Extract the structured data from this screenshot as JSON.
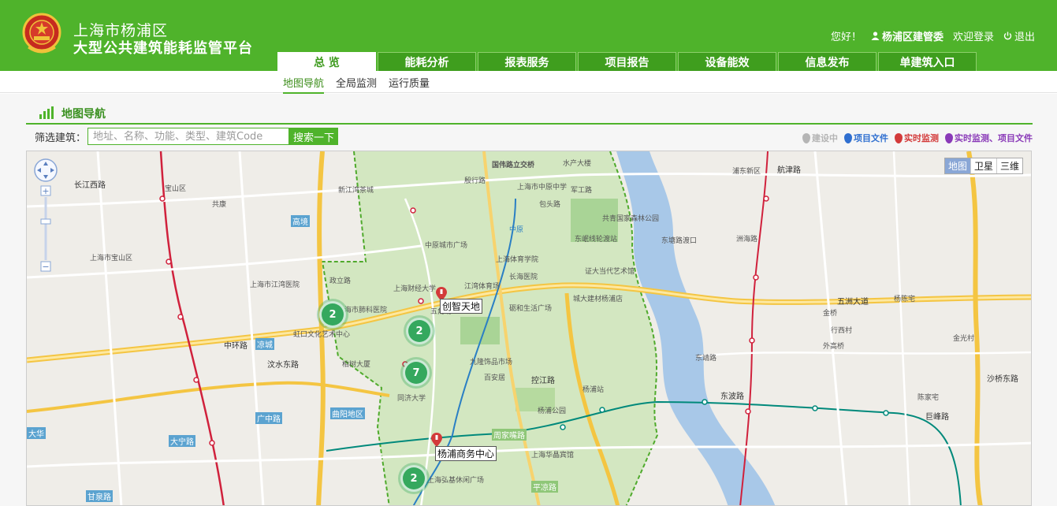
{
  "header": {
    "brand_line1": "上海市杨浦区",
    "brand_line2": "大型公共建筑能耗监管平台",
    "greeting": "您好！",
    "user": "杨浦区建管委",
    "welcome": "欢迎登录",
    "logout": "退出"
  },
  "nav": {
    "tabs": [
      {
        "label": "总  览",
        "active": true
      },
      {
        "label": "能耗分析"
      },
      {
        "label": "报表服务"
      },
      {
        "label": "项目报告"
      },
      {
        "label": "设备能效"
      },
      {
        "label": "信息发布"
      },
      {
        "label": "单建筑入口"
      }
    ]
  },
  "subnav": {
    "items": [
      {
        "label": "地图导航",
        "active": true
      },
      {
        "label": "全局监测"
      },
      {
        "label": "运行质量"
      }
    ]
  },
  "section": {
    "title": "地图导航"
  },
  "filter": {
    "label": "筛选建筑：",
    "placeholder": "地址、名称、功能、类型、建筑Code",
    "button": "搜索一下"
  },
  "legend": [
    {
      "label": "建设中",
      "color": "#b5b5b5"
    },
    {
      "label": "项目文件",
      "color": "#2f6fd0"
    },
    {
      "label": "实时监测",
      "color": "#d33a3a"
    },
    {
      "label": "实时监测、项目文件",
      "color": "#8a3ab8"
    }
  ],
  "map": {
    "types": [
      "地图",
      "卫星",
      "三维"
    ],
    "clusters": [
      "2",
      "2",
      "7",
      "2"
    ],
    "poi_labels": [
      "创智天地",
      "杨浦商务中心"
    ],
    "places": [
      "国伟路立交桥",
      "殷行路",
      "水产大楼",
      "新江湾茶城",
      "上海市中原中学",
      "军工路",
      "中原",
      "包头路",
      "中原城市广场",
      "上海体育学院",
      "长海医院",
      "共青国家森林公园",
      "东岷线轮渡站",
      "东塘路渡口",
      "政立路",
      "上海财经大学",
      "江湾体育场",
      "证大当代艺术馆",
      "城大建材杨浦店",
      "上海市肺科医院",
      "五角场",
      "砺和生活广场",
      "上海市江湾医院",
      "虹口文化艺术中心",
      "柏树大厦",
      "九隆饰品市场",
      "百安居",
      "同济大学",
      "杨浦站",
      "杨浦公园",
      "控江路",
      "周家嘴路",
      "上海华晶宾馆",
      "平凉路",
      "上海弘基休闲广场",
      "曲阳地区",
      "凉城",
      "广中路",
      "汶水东路",
      "中环路",
      "五洲大道",
      "洲海路",
      "外高桥",
      "东靖路",
      "金桥",
      "长江西路",
      "宝山区",
      "共康",
      "大华",
      "大宁路",
      "甘泉路",
      "浦东新区",
      "航津路",
      "沙桥东路",
      "巨峰路",
      "陈家宅",
      "行西村",
      "金光村",
      "东波路",
      "高境",
      "上海市宝山区",
      "杨陈宅"
    ]
  }
}
